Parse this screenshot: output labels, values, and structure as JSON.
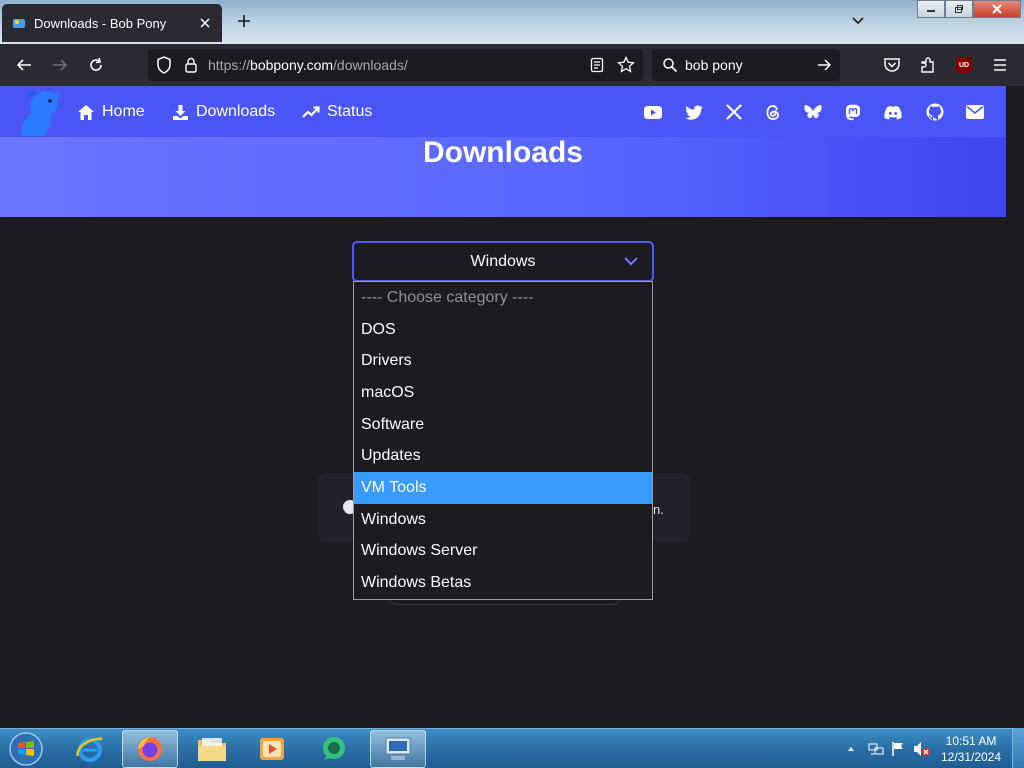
{
  "browser": {
    "tab_title": "Downloads - Bob Pony",
    "url_prefix": "https://",
    "url_host": "bobpony.com",
    "url_path": "/downloads/",
    "search_text": "bob pony",
    "extension_badge": "UD"
  },
  "site_nav": {
    "home": "Home",
    "downloads": "Downloads",
    "status": "Status",
    "social_icons": [
      "youtube-icon",
      "twitter-icon",
      "x-icon",
      "threads-icon",
      "bluesky-icon",
      "mastodon-icon",
      "discord-icon",
      "github-icon",
      "email-icon"
    ]
  },
  "page": {
    "title": "Downloads",
    "notice_tail": "n."
  },
  "category_select": {
    "selected": "Windows",
    "highlighted": "VM Tools",
    "options": [
      "---- Choose category ----",
      "DOS",
      "Drivers",
      "macOS",
      "Software",
      "Updates",
      "VM Tools",
      "Windows",
      "Windows Server",
      "Windows Betas"
    ]
  },
  "taskbar": {
    "time": "10:51 AM",
    "date": "12/31/2024"
  },
  "colors": {
    "accent": "#4a55f6",
    "highlight": "#3a9bff",
    "taskbar": "#2a6fa6"
  }
}
